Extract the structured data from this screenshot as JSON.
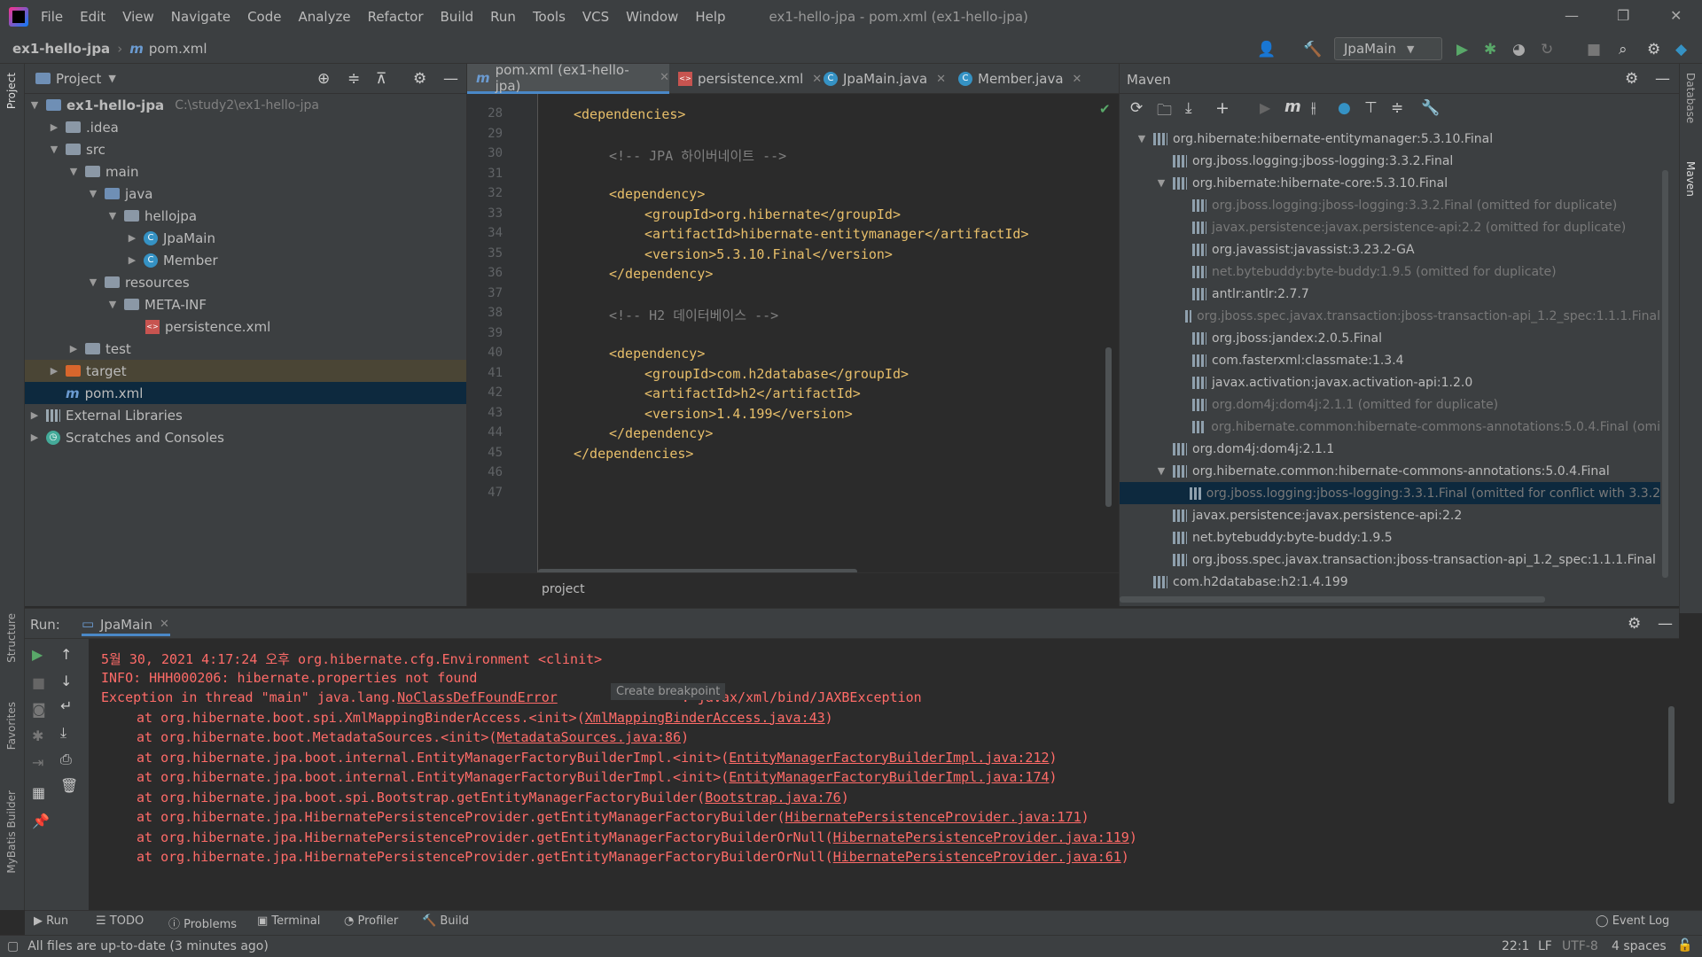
{
  "menubar": {
    "items": [
      "File",
      "Edit",
      "View",
      "Navigate",
      "Code",
      "Analyze",
      "Refactor",
      "Build",
      "Run",
      "Tools",
      "VCS",
      "Window",
      "Help"
    ],
    "title": "ex1-hello-jpa - pom.xml (ex1-hello-jpa)"
  },
  "navbar": {
    "project": "ex1-hello-jpa",
    "file": "pom.xml",
    "run_config": "JpaMain"
  },
  "left_strip": {
    "project": "Project",
    "structure": "Structure",
    "favorites": "Favorites",
    "mybatis": "MyBatis Builder"
  },
  "right_strip": {
    "database": "Database",
    "maven": "Maven"
  },
  "project_panel": {
    "title": "Project",
    "root": "ex1-hello-jpa",
    "root_path": "C:\\study2\\ex1-hello-jpa",
    "items": {
      "idea": ".idea",
      "src": "src",
      "main": "main",
      "java": "java",
      "hellojpa": "hellojpa",
      "jpamain": "JpaMain",
      "member": "Member",
      "resources": "resources",
      "metainf": "META-INF",
      "persistence": "persistence.xml",
      "test": "test",
      "target": "target",
      "pom": "pom.xml",
      "extlibs": "External Libraries",
      "scratches": "Scratches and Consoles"
    }
  },
  "editor": {
    "tabs": [
      "pom.xml (ex1-hello-jpa)",
      "persistence.xml",
      "JpaMain.java",
      "Member.java"
    ],
    "lines": [
      {
        "n": "28",
        "text": "<dependencies>",
        "indent": 0,
        "kind": "tag"
      },
      {
        "n": "29",
        "text": "",
        "indent": 0,
        "kind": "tag"
      },
      {
        "n": "30",
        "text": "<!-- JPA 하이버네이트 -->",
        "indent": 1,
        "kind": "comment"
      },
      {
        "n": "31",
        "text": "",
        "indent": 0,
        "kind": "tag"
      },
      {
        "n": "32",
        "text": "<dependency>",
        "indent": 1,
        "kind": "tag"
      },
      {
        "n": "33",
        "text": "<groupId>org.hibernate</groupId>",
        "indent": 2,
        "kind": "tag"
      },
      {
        "n": "34",
        "text": "<artifactId>hibernate-entitymanager</artifactId>",
        "indent": 2,
        "kind": "tag"
      },
      {
        "n": "35",
        "text": "<version>5.3.10.Final</version>",
        "indent": 2,
        "kind": "tag"
      },
      {
        "n": "36",
        "text": "</dependency>",
        "indent": 1,
        "kind": "tag"
      },
      {
        "n": "37",
        "text": "",
        "indent": 0,
        "kind": "tag"
      },
      {
        "n": "38",
        "text": "<!-- H2 데이터베이스 -->",
        "indent": 1,
        "kind": "comment"
      },
      {
        "n": "39",
        "text": "",
        "indent": 0,
        "kind": "tag"
      },
      {
        "n": "40",
        "text": "<dependency>",
        "indent": 1,
        "kind": "tag"
      },
      {
        "n": "41",
        "text": "<groupId>com.h2database</groupId>",
        "indent": 2,
        "kind": "tag"
      },
      {
        "n": "42",
        "text": "<artifactId>h2</artifactId>",
        "indent": 2,
        "kind": "tag"
      },
      {
        "n": "43",
        "text": "<version>1.4.199</version>",
        "indent": 2,
        "kind": "tag"
      },
      {
        "n": "44",
        "text": "</dependency>",
        "indent": 1,
        "kind": "tag"
      },
      {
        "n": "45",
        "text": "</dependencies>",
        "indent": 0,
        "kind": "tag"
      },
      {
        "n": "46",
        "text": "",
        "indent": 0,
        "kind": "tag"
      },
      {
        "n": "47",
        "text": "",
        "indent": 0,
        "kind": "tag"
      }
    ],
    "breadcrumb": "project"
  },
  "maven": {
    "title": "Maven",
    "rows": [
      {
        "text": "org.hibernate:hibernate-entitymanager:5.3.10.Final",
        "level": 1,
        "chev": "v",
        "omit": false,
        "sel": false
      },
      {
        "text": "org.jboss.logging:jboss-logging:3.3.2.Final",
        "level": 2,
        "chev": "",
        "omit": false,
        "sel": false
      },
      {
        "text": "org.hibernate:hibernate-core:5.3.10.Final",
        "level": 2,
        "chev": "v",
        "omit": false,
        "sel": false
      },
      {
        "text": "org.jboss.logging:jboss-logging:3.3.2.Final (omitted for duplicate)",
        "level": 3,
        "chev": "",
        "omit": true,
        "sel": false
      },
      {
        "text": "javax.persistence:javax.persistence-api:2.2 (omitted for duplicate)",
        "level": 3,
        "chev": "",
        "omit": true,
        "sel": false
      },
      {
        "text": "org.javassist:javassist:3.23.2-GA",
        "level": 3,
        "chev": "",
        "omit": false,
        "sel": false
      },
      {
        "text": "net.bytebuddy:byte-buddy:1.9.5 (omitted for duplicate)",
        "level": 3,
        "chev": "",
        "omit": true,
        "sel": false
      },
      {
        "text": "antlr:antlr:2.7.7",
        "level": 3,
        "chev": "",
        "omit": false,
        "sel": false
      },
      {
        "text": "org.jboss.spec.javax.transaction:jboss-transaction-api_1.2_spec:1.1.1.Final",
        "level": 3,
        "chev": "",
        "omit": true,
        "sel": false
      },
      {
        "text": "org.jboss:jandex:2.0.5.Final",
        "level": 3,
        "chev": "",
        "omit": false,
        "sel": false
      },
      {
        "text": "com.fasterxml:classmate:1.3.4",
        "level": 3,
        "chev": "",
        "omit": false,
        "sel": false
      },
      {
        "text": "javax.activation:javax.activation-api:1.2.0",
        "level": 3,
        "chev": "",
        "omit": false,
        "sel": false
      },
      {
        "text": "org.dom4j:dom4j:2.1.1 (omitted for duplicate)",
        "level": 3,
        "chev": "",
        "omit": true,
        "sel": false
      },
      {
        "text": "org.hibernate.common:hibernate-commons-annotations:5.0.4.Final (omi",
        "level": 3,
        "chev": "",
        "omit": true,
        "sel": false
      },
      {
        "text": "org.dom4j:dom4j:2.1.1",
        "level": 2,
        "chev": "",
        "omit": false,
        "sel": false
      },
      {
        "text": "org.hibernate.common:hibernate-commons-annotations:5.0.4.Final",
        "level": 2,
        "chev": "v",
        "omit": false,
        "sel": false
      },
      {
        "text": "org.jboss.logging:jboss-logging:3.3.1.Final (omitted for conflict with 3.3.2",
        "level": 3,
        "chev": "",
        "omit": true,
        "sel": true
      },
      {
        "text": "javax.persistence:javax.persistence-api:2.2",
        "level": 2,
        "chev": "",
        "omit": false,
        "sel": false
      },
      {
        "text": "net.bytebuddy:byte-buddy:1.9.5",
        "level": 2,
        "chev": "",
        "omit": false,
        "sel": false
      },
      {
        "text": "org.jboss.spec.javax.transaction:jboss-transaction-api_1.2_spec:1.1.1.Final",
        "level": 2,
        "chev": "",
        "omit": false,
        "sel": false
      },
      {
        "text": "com.h2database:h2:1.4.199",
        "level": 1,
        "chev": "",
        "omit": false,
        "sel": false
      }
    ]
  },
  "run": {
    "label": "Run:",
    "tab": "JpaMain",
    "tooltip": "Create breakpoint",
    "lines": [
      {
        "pre": "5월 30, 2021 4:17:24 오후 org.hibernate.cfg.Environment <clinit>",
        "link": "",
        "post": "",
        "indent": false
      },
      {
        "pre": "INFO: HHH000206: hibernate.properties not found",
        "link": "",
        "post": "",
        "indent": false
      },
      {
        "pre": "Exception in thread \"main\" java.lang.",
        "link": "NoClassDefFoundError",
        "post": ": javax/xml/bind/JAXBException",
        "indent": false
      },
      {
        "pre": "at org.hibernate.boot.spi.XmlMappingBinderAccess.<init>(",
        "link": "XmlMappingBinderAccess.java:43",
        "post": ")",
        "indent": true
      },
      {
        "pre": "at org.hibernate.boot.MetadataSources.<init>(",
        "link": "MetadataSources.java:86",
        "post": ")",
        "indent": true
      },
      {
        "pre": "at org.hibernate.jpa.boot.internal.EntityManagerFactoryBuilderImpl.<init>(",
        "link": "EntityManagerFactoryBuilderImpl.java:212",
        "post": ")",
        "indent": true
      },
      {
        "pre": "at org.hibernate.jpa.boot.internal.EntityManagerFactoryBuilderImpl.<init>(",
        "link": "EntityManagerFactoryBuilderImpl.java:174",
        "post": ")",
        "indent": true
      },
      {
        "pre": "at org.hibernate.jpa.boot.spi.Bootstrap.getEntityManagerFactoryBuilder(",
        "link": "Bootstrap.java:76",
        "post": ")",
        "indent": true
      },
      {
        "pre": "at org.hibernate.jpa.HibernatePersistenceProvider.getEntityManagerFactoryBuilder(",
        "link": "HibernatePersistenceProvider.java:171",
        "post": ")",
        "indent": true
      },
      {
        "pre": "at org.hibernate.jpa.HibernatePersistenceProvider.getEntityManagerFactoryBuilderOrNull(",
        "link": "HibernatePersistenceProvider.java:119",
        "post": ")",
        "indent": true
      },
      {
        "pre": "at org.hibernate.jpa.HibernatePersistenceProvider.getEntityManagerFactoryBuilderOrNull(",
        "link": "HibernatePersistenceProvider.java:61",
        "post": ")",
        "indent": true
      }
    ]
  },
  "bottom_tabs": [
    "Run",
    "TODO",
    "Problems",
    "Terminal",
    "Profiler",
    "Build"
  ],
  "event_log": "Event Log",
  "status": {
    "message": "All files are up-to-date (3 minutes ago)",
    "position": "22:1",
    "line_sep": "LF",
    "encoding": "UTF-8",
    "indent": "4 spaces"
  },
  "colors": {
    "accent": "#4a88c7",
    "error": "#ff6b68",
    "tag": "#e8bf6a",
    "comment": "#808080"
  }
}
